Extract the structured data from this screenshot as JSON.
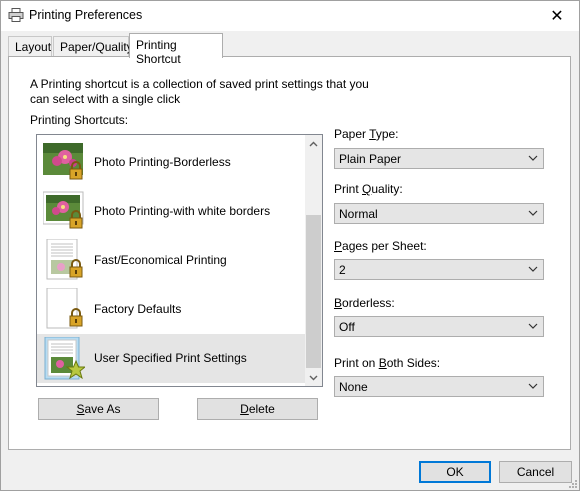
{
  "window": {
    "title": "Printing Preferences",
    "close_glyph": "✕",
    "icon": "printer-icon"
  },
  "tabs": [
    {
      "label": "Layout",
      "active": false
    },
    {
      "label": "Paper/Quality",
      "active": false
    },
    {
      "label": "Printing Shortcut",
      "active": true
    }
  ],
  "shortcut_panel": {
    "description": "A Printing shortcut is a collection of saved print settings that you can select with a single click",
    "list_label": "Printing Shortcuts:",
    "items": [
      {
        "label": "Photo Printing-Borderless",
        "thumb": "photo-borderless-icon",
        "badge": "lock-icon",
        "selected": false
      },
      {
        "label": "Photo Printing-with white borders",
        "thumb": "photo-white-borders-icon",
        "badge": "lock-icon",
        "selected": false
      },
      {
        "label": "Fast/Economical Printing",
        "thumb": "economical-page-icon",
        "badge": "lock-icon",
        "selected": false
      },
      {
        "label": "Factory Defaults",
        "thumb": "blank-page-icon",
        "badge": "lock-icon",
        "selected": false
      },
      {
        "label": "User Specified Print Settings",
        "thumb": "user-page-icon",
        "badge": "star-icon",
        "selected": true
      }
    ],
    "save_as_prefix": "",
    "save_as_accel": "S",
    "save_as_rest": "ave As",
    "delete_accel": "D",
    "delete_rest": "elete"
  },
  "settings": [
    {
      "label_pre": "Paper ",
      "label_accel": "T",
      "label_post": "ype:",
      "value": "Plain Paper"
    },
    {
      "label_pre": "Print ",
      "label_accel": "Q",
      "label_post": "uality:",
      "value": "Normal"
    },
    {
      "label_pre": "",
      "label_accel": "P",
      "label_post": "ages per Sheet:",
      "value": "2"
    },
    {
      "label_pre": "",
      "label_accel": "B",
      "label_post": "orderless:",
      "value": "Off"
    },
    {
      "label_pre": "Print on ",
      "label_accel": "B",
      "label_post": "oth Sides:",
      "value": "None"
    }
  ],
  "footer": {
    "ok_label": "OK",
    "cancel_label": "Cancel"
  },
  "colors": {
    "accent": "#0078d7",
    "selected_row": "#e5e5e5",
    "lock": "#c8961e"
  }
}
